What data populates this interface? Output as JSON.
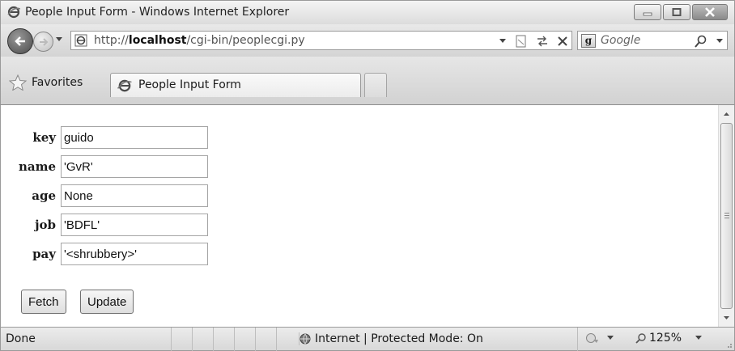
{
  "window": {
    "title": "People Input Form - Windows Internet Explorer"
  },
  "addressbar": {
    "url_prefix": "http://",
    "url_host": "localhost",
    "url_path": "/cgi-bin/peoplecgi.py"
  },
  "searchbar": {
    "placeholder": "Google"
  },
  "favorites": {
    "label": "Favorites"
  },
  "tabs": [
    {
      "label": "People Input Form"
    }
  ],
  "form": {
    "fields": [
      {
        "label": "key",
        "value": "guido"
      },
      {
        "label": "name",
        "value": "'GvR'"
      },
      {
        "label": "age",
        "value": "None"
      },
      {
        "label": "job",
        "value": "'BDFL'"
      },
      {
        "label": "pay",
        "value": "'<shrubbery>'"
      }
    ],
    "fetch_label": "Fetch",
    "update_label": "Update"
  },
  "statusbar": {
    "status": "Done",
    "zone": "Internet | Protected Mode: On",
    "zoom": "125%"
  },
  "icons": {
    "browser": "ie-logo-icon",
    "back": "back-arrow-icon",
    "forward": "forward-arrow-icon",
    "compat": "compatibility-view-icon",
    "refresh": "refresh-icon",
    "stop": "stop-icon",
    "search": "search-icon",
    "favorites": "star-icon",
    "zone": "globe-icon"
  }
}
